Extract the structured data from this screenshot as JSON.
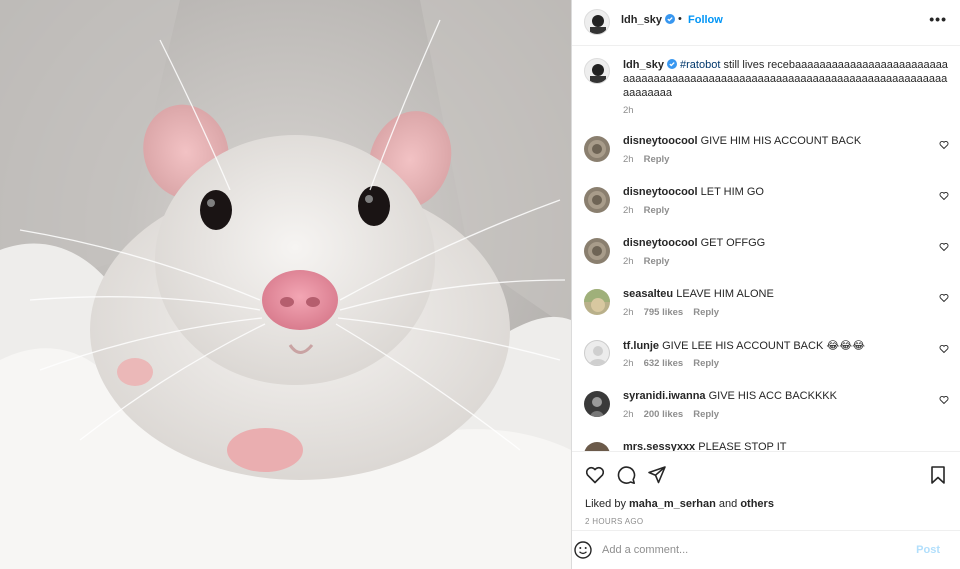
{
  "colors": {
    "accent": "#0095f6",
    "verified": "#3897f0",
    "muted": "#8e8e8e",
    "post_disabled": "#b2dffc"
  },
  "header": {
    "username": "ldh_sky",
    "dot": "•",
    "follow_label": "Follow",
    "more_icon": "more-horizontal-icon"
  },
  "caption": {
    "username": "ldh_sky",
    "hashtag": "#ratobot",
    "text": " still lives recebaaaaaaaaaaaaaaaaaaaaaaaaaaaaaaaaaaaaaaaaaaaaaaaaaaaaaaaaaaaaaaaaaaaaaaaaaaaaaaaaaaaaaa",
    "time": "2h"
  },
  "comments": [
    {
      "username": "disneytoocool",
      "text": "GIVE HIM HIS ACCOUNT BACK",
      "time": "2h",
      "likes": "",
      "reply": "Reply"
    },
    {
      "username": "disneytoocool",
      "text": "LET HIM GO",
      "time": "2h",
      "likes": "",
      "reply": "Reply"
    },
    {
      "username": "disneytoocool",
      "text": "GET OFFGG",
      "time": "2h",
      "likes": "",
      "reply": "Reply"
    },
    {
      "username": "seasalteu",
      "text": "LEAVE HIM ALONE",
      "time": "2h",
      "likes": "795 likes",
      "reply": "Reply"
    },
    {
      "username": "tf.lunje",
      "text": "GIVE LEE HIS ACCOUNT BACK",
      "emoji": "😂😂😂",
      "time": "2h",
      "likes": "632 likes",
      "reply": "Reply"
    },
    {
      "username": "syranidi.iwanna",
      "text": "GIVE HIS ACC BACKKKK",
      "time": "2h",
      "likes": "200 likes",
      "reply": "Reply"
    },
    {
      "username": "mrs.sessyxxx",
      "text": "PLEASE STOP IT",
      "time": "",
      "likes": "",
      "reply": ""
    }
  ],
  "actions": {
    "icons": [
      "heart-icon",
      "comment-icon",
      "share-icon",
      "bookmark-icon"
    ]
  },
  "likes": {
    "prefix": "Liked by ",
    "user": "maha_m_serhan",
    "middle": " and ",
    "others": "others"
  },
  "timestamp": "2 HOURS AGO",
  "add_comment": {
    "placeholder": "Add a comment...",
    "post_label": "Post"
  }
}
